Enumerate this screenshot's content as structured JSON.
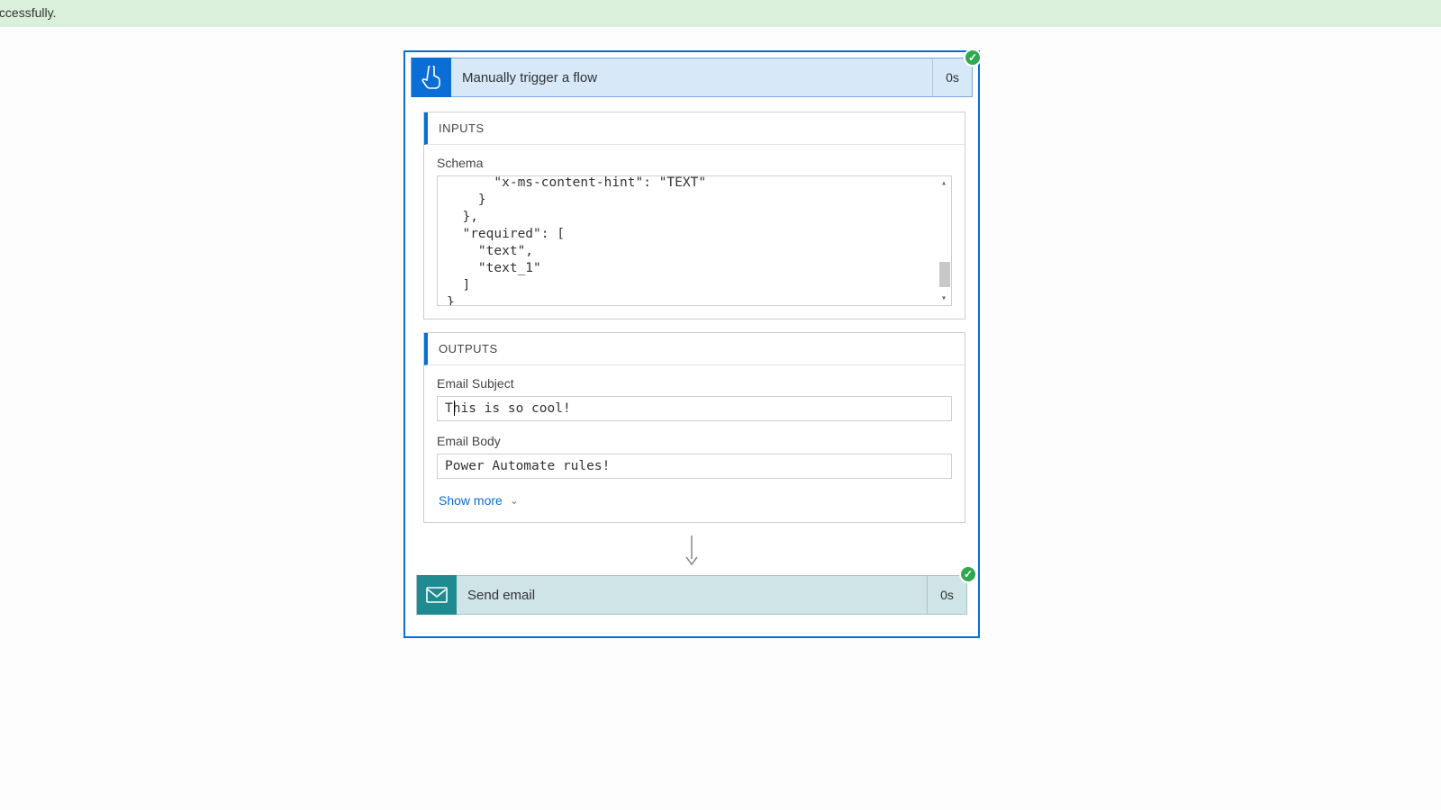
{
  "banner": {
    "text": "ran successfully."
  },
  "flow": {
    "trigger": {
      "title": "Manually trigger a flow",
      "duration": "0s",
      "inputs_heading": "INPUTS",
      "schema_label": "Schema",
      "schema_text": "      \"x-ms-content-hint\": \"TEXT\"\n    }\n  },\n  \"required\": [\n    \"text\",\n    \"text_1\"\n  ]\n}",
      "outputs_heading": "OUTPUTS",
      "subject_label": "Email Subject",
      "subject_value": "This is so cool!",
      "body_label": "Email Body",
      "body_value": "Power Automate rules!",
      "show_more": "Show more"
    },
    "send_email": {
      "title": "Send email",
      "duration": "0s"
    }
  }
}
